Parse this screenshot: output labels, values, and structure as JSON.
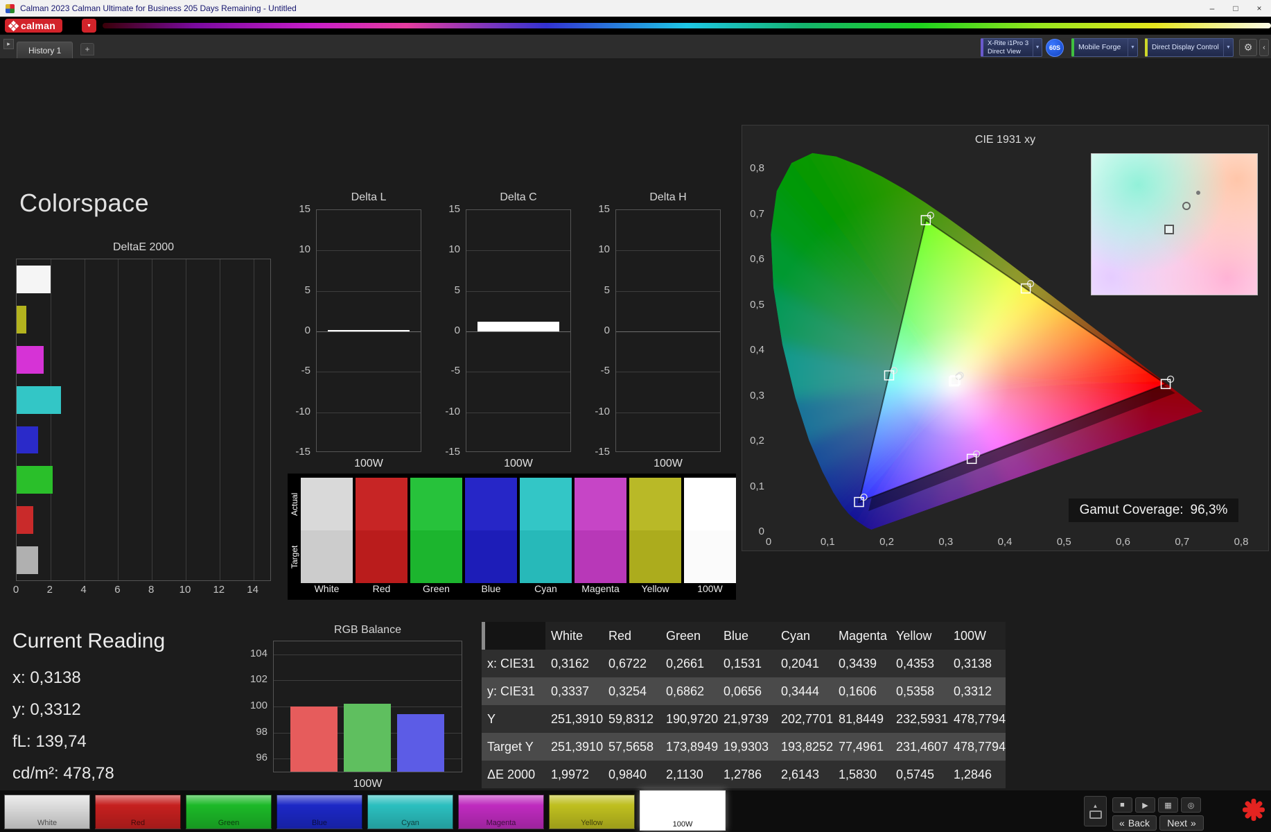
{
  "window": {
    "title": "Calman 2023 Calman Ultimate for Business 205 Days Remaining  - Untitled"
  },
  "logo": {
    "brand": "calman"
  },
  "tabs": {
    "active": "History 1"
  },
  "toolbar": {
    "meter_device": {
      "line1": "X-Rite i1Pro 3",
      "line2": "Direct View"
    },
    "exposure_badge": "60S",
    "workflow_button": "Mobile Forge",
    "display_control_button": "Direct Display Control"
  },
  "page": {
    "title": "Colorspace"
  },
  "current_reading": {
    "title": "Current Reading",
    "lines": [
      "x: 0,3138",
      "y: 0,3312",
      "fL: 139,74",
      "cd/m²: 478,78"
    ]
  },
  "swatch_panel": {
    "row_labels": [
      "Actual",
      "Target"
    ],
    "swatches": [
      {
        "label": "White",
        "actual": "#d9d9d9",
        "target": "#cccccc"
      },
      {
        "label": "Red",
        "actual": "#c72525",
        "target": "#ba1c1c"
      },
      {
        "label": "Green",
        "actual": "#27c23b",
        "target": "#1cb52e"
      },
      {
        "label": "Blue",
        "actual": "#2626c7",
        "target": "#1d1db8"
      },
      {
        "label": "Cyan",
        "actual": "#33c6c6",
        "target": "#27b9b9"
      },
      {
        "label": "Magenta",
        "actual": "#c645c6",
        "target": "#b838b8"
      },
      {
        "label": "Yellow",
        "actual": "#b9b927",
        "target": "#acac1d"
      },
      {
        "label": "100W",
        "actual": "#ffffff",
        "target": "#fbfbfb"
      }
    ]
  },
  "bottom_bar": {
    "patches": [
      {
        "label": "White",
        "color": "#dcdcdc",
        "selected": false
      },
      {
        "label": "Red",
        "color": "#c6201f",
        "selected": false
      },
      {
        "label": "Green",
        "color": "#1cb928",
        "selected": false
      },
      {
        "label": "Blue",
        "color": "#1c28c6",
        "selected": false
      },
      {
        "label": "Cyan",
        "color": "#2bbfbf",
        "selected": false
      },
      {
        "label": "Magenta",
        "color": "#bf2bbf",
        "selected": false
      },
      {
        "label": "Yellow",
        "color": "#bfbf1f",
        "selected": false
      },
      {
        "label": "100W",
        "color": "#ffffff",
        "selected": true
      }
    ],
    "back_label": "Back",
    "next_label": "Next"
  },
  "icons": {
    "minimize": "–",
    "maximize": "□",
    "close": "×",
    "dropdown": "▼",
    "gear": "⚙",
    "collapse": "‹",
    "tab_arrow": "▸",
    "add_tab": "+",
    "back": "«",
    "next": "»",
    "stop": "■",
    "play": "▶",
    "save": "▦",
    "link": "◎",
    "screen_up": "▲"
  },
  "chart_data": [
    {
      "type": "bar",
      "title": "DeltaE 2000",
      "orientation": "horizontal",
      "categories": [
        "White",
        "Yellow",
        "Magenta",
        "Cyan",
        "Blue",
        "Green",
        "Red",
        "100W"
      ],
      "values": [
        1.9972,
        0.5745,
        1.583,
        2.6143,
        1.2786,
        2.113,
        0.984,
        1.2846
      ],
      "colors": [
        "#f5f5f5",
        "#b3b31e",
        "#d633d6",
        "#33c6c6",
        "#2a2ac9",
        "#2abf2a",
        "#c92a2a",
        "#b0b0b0"
      ],
      "xlim": [
        0,
        15
      ],
      "xticks": [
        0,
        2,
        4,
        6,
        8,
        10,
        12,
        14
      ]
    },
    {
      "type": "bar",
      "title": "Delta L",
      "categories": [
        "100W"
      ],
      "values": [
        0.15
      ],
      "ylim": [
        -15,
        15
      ],
      "yticks": [
        15,
        10,
        5,
        0,
        -5,
        -10,
        -15
      ],
      "bar_color": "#ffffff",
      "xlabel": "100W"
    },
    {
      "type": "bar",
      "title": "Delta C",
      "categories": [
        "100W"
      ],
      "values": [
        1.2
      ],
      "ylim": [
        -15,
        15
      ],
      "yticks": [
        15,
        10,
        5,
        0,
        -5,
        -10,
        -15
      ],
      "bar_color": "#ffffff",
      "xlabel": "100W"
    },
    {
      "type": "bar",
      "title": "Delta H",
      "categories": [
        "100W"
      ],
      "values": [
        0
      ],
      "ylim": [
        -15,
        15
      ],
      "yticks": [
        15,
        10,
        5,
        0,
        -5,
        -10,
        -15
      ],
      "bar_color": "#ffffff",
      "xlabel": "100W"
    },
    {
      "type": "bar",
      "title": "RGB Balance",
      "categories": [
        "Red",
        "Green",
        "Blue"
      ],
      "values": [
        100.0,
        100.2,
        99.4
      ],
      "colors": [
        "#e65c5c",
        "#5fbf5f",
        "#5c5ce6"
      ],
      "ylim": [
        95,
        105
      ],
      "yticks": [
        104,
        102,
        100,
        98,
        96
      ],
      "xlabel": "100W"
    },
    {
      "type": "scatter",
      "title": "CIE 1931 xy",
      "points": [
        {
          "name": "White",
          "x": 0.3162,
          "y": 0.3337
        },
        {
          "name": "Red",
          "x": 0.6722,
          "y": 0.3254
        },
        {
          "name": "Green",
          "x": 0.2661,
          "y": 0.6862
        },
        {
          "name": "Blue",
          "x": 0.1531,
          "y": 0.0656
        },
        {
          "name": "Cyan",
          "x": 0.2041,
          "y": 0.3444
        },
        {
          "name": "Magenta",
          "x": 0.3439,
          "y": 0.1606
        },
        {
          "name": "Yellow",
          "x": 0.4353,
          "y": 0.5358
        },
        {
          "name": "100W",
          "x": 0.3138,
          "y": 0.3312
        }
      ],
      "triangle": [
        "Red",
        "Green",
        "Blue"
      ],
      "xlim": [
        0,
        0.8
      ],
      "ylim": [
        0,
        0.8
      ],
      "xticks": [
        "0",
        "0,1",
        "0,2",
        "0,3",
        "0,4",
        "0,5",
        "0,6",
        "0,7",
        "0,8"
      ],
      "yticks": [
        "0,8",
        "0,7",
        "0,6",
        "0,5",
        "0,4",
        "0,3",
        "0,2",
        "0,1",
        "0"
      ],
      "gamut_coverage_label": "Gamut Coverage:",
      "gamut_coverage_value": "96,3%"
    },
    {
      "type": "table",
      "columns": [
        "",
        "White",
        "Red",
        "Green",
        "Blue",
        "Cyan",
        "Magenta",
        "Yellow",
        "100W"
      ],
      "rows": [
        {
          "label": "x: CIE31",
          "values": [
            "0,3162",
            "0,6722",
            "0,2661",
            "0,1531",
            "0,2041",
            "0,3439",
            "0,4353",
            "0,3138"
          ]
        },
        {
          "label": "y: CIE31",
          "values": [
            "0,3337",
            "0,3254",
            "0,6862",
            "0,0656",
            "0,3444",
            "0,1606",
            "0,5358",
            "0,3312"
          ]
        },
        {
          "label": "Y",
          "values": [
            "251,3910",
            "59,8312",
            "190,9720",
            "21,9739",
            "202,7701",
            "81,8449",
            "232,5931",
            "478,7794"
          ]
        },
        {
          "label": "Target Y",
          "values": [
            "251,3910",
            "57,5658",
            "173,8949",
            "19,9303",
            "193,8252",
            "77,4961",
            "231,4607",
            "478,7794"
          ]
        },
        {
          "label": "ΔE 2000",
          "values": [
            "1,9972",
            "0,9840",
            "2,1130",
            "1,2786",
            "2,6143",
            "1,5830",
            "0,5745",
            "1,2846"
          ]
        }
      ]
    }
  ]
}
